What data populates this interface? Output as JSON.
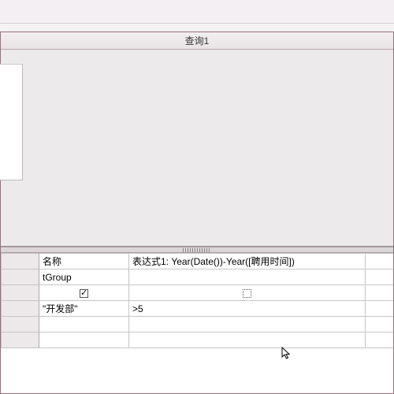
{
  "window": {
    "title": "查询1"
  },
  "grid": {
    "field_row": {
      "col1": "名称",
      "col2": "表达式1: Year(Date())-Year([聘用时间])"
    },
    "table_row": {
      "col1": "tGroup"
    },
    "criteria_row": {
      "col1": "\"开发部\"",
      "col2": ">5"
    }
  }
}
